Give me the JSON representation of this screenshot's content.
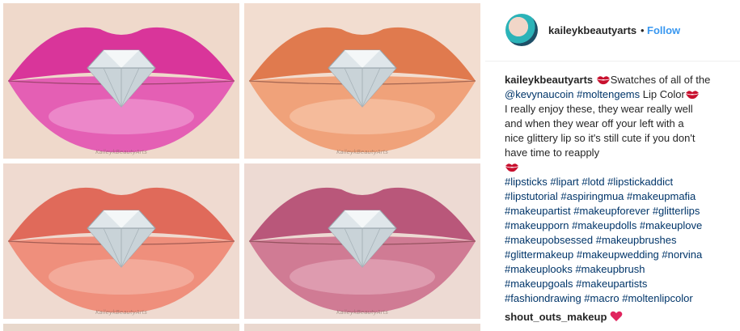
{
  "post": {
    "photos": [
      {
        "name": "pink",
        "watermark": "KaileykBeautyArts"
      },
      {
        "name": "orange",
        "watermark": "KaileykBeautyArts"
      },
      {
        "name": "coral",
        "watermark": "KaileykBeautyArts"
      },
      {
        "name": "mauve",
        "watermark": "KaileykBeautyArts"
      }
    ]
  },
  "header": {
    "username": "kaileykbeautyarts",
    "separator": "•",
    "follow_label": "Follow"
  },
  "caption": {
    "author": "kaileykbeautyarts",
    "line1_text": "Swatches of all of the",
    "mention": "@kevynaucoin",
    "tag_moltengems": "#moltengems",
    "line2_text": "Lip Color",
    "line3": "I really enjoy these, they wear really well",
    "line4": "and when they wear off your left with a",
    "line5": "nice glittery lip so it's still cute if you don't",
    "line6": "have time to reapply",
    "hashtag_lines": [
      "#lipsticks #lipart #lotd #lipstickaddict",
      "#lipstutorial #aspiringmua #makeupmafia",
      "#makeupartist #makeupforever #glitterlips",
      "#makeupporn #makeupdolls #makeuplove",
      "#makeupobsessed #makeupbrushes",
      "#glittermakeup #makeupwedding #norvina",
      "#makeuplooks #makeupbrush",
      "#makeupgoals #makeupartists",
      "#fashiondrawing #macro #moltenlipcolor"
    ]
  },
  "comment": {
    "username": "shout_outs_makeup"
  },
  "icons": {
    "kiss": "kiss-mark-icon",
    "heart": "red-heart-icon"
  },
  "colors": {
    "link": "#003569",
    "follow": "#3897f0",
    "kiss": "#c8102e",
    "heart": "#e0245e"
  }
}
